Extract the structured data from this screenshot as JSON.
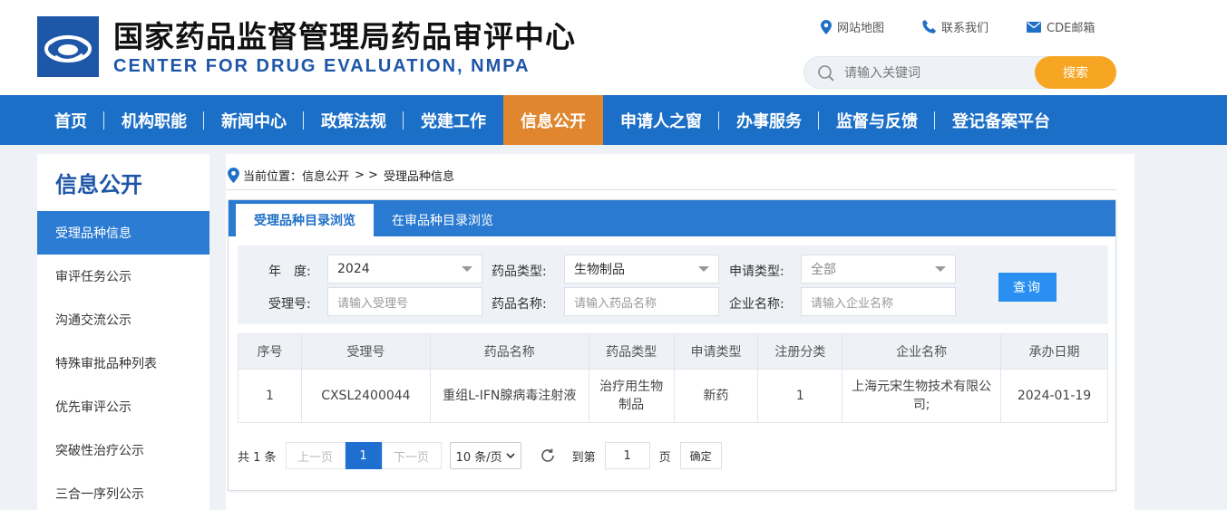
{
  "header": {
    "title_cn": "国家药品监督管理局药品审评中心",
    "title_en": "CENTER FOR DRUG EVALUATION, NMPA",
    "links": [
      "网站地图",
      "联系我们",
      "CDE邮箱"
    ],
    "search_placeholder": "请输入关键词",
    "search_button": "搜索"
  },
  "nav": {
    "items": [
      "首页",
      "机构职能",
      "新闻中心",
      "政策法规",
      "党建工作",
      "信息公开",
      "申请人之窗",
      "办事服务",
      "监督与反馈",
      "登记备案平台"
    ],
    "active": "信息公开"
  },
  "sidebar": {
    "title": "信息公开",
    "items": [
      "受理品种信息",
      "审评任务公示",
      "沟通交流公示",
      "特殊审批品种列表",
      "优先审评公示",
      "突破性治疗公示",
      "三合一序列公示"
    ]
  },
  "breadcrumb": {
    "prefix": "当前位置：",
    "parent": "信息公开",
    "sep": "> >",
    "current": "受理品种信息"
  },
  "tabs": [
    "受理品种目录浏览",
    "在审品种目录浏览"
  ],
  "filter": {
    "year_label": "年　度:",
    "year_value": "2024",
    "drug_type_label": "药品类型:",
    "drug_type_value": "生物制品",
    "apply_type_label": "申请类型:",
    "apply_type_value": "全部",
    "accept_no_label": "受理号:",
    "accept_no_placeholder": "请输入受理号",
    "drug_name_label": "药品名称:",
    "drug_name_placeholder": "请输入药品名称",
    "company_label": "企业名称:",
    "company_placeholder": "请输入企业名称",
    "query_button": "查询"
  },
  "table": {
    "headers": [
      "序号",
      "受理号",
      "药品名称",
      "药品类型",
      "申请类型",
      "注册分类",
      "企业名称",
      "承办日期"
    ],
    "rows": [
      [
        "1",
        "CXSL2400044",
        "重组L-IFN腺病毒注射液",
        "治疗用生物制品",
        "新药",
        "1",
        "上海元宋生物技术有限公司;",
        "2024-01-19"
      ]
    ]
  },
  "pager": {
    "total": "共 1 条",
    "prev": "上一页",
    "current": "1",
    "next": "下一页",
    "page_size": "10 条/页",
    "goto_label": "到第",
    "goto_value": "1",
    "page_unit": "页",
    "confirm": "确定"
  },
  "colors": {
    "nav_blue": "#1c6fc7",
    "active_orange": "#e0862f",
    "search_orange": "#f6a623",
    "brand_blue": "#1e56a8"
  }
}
